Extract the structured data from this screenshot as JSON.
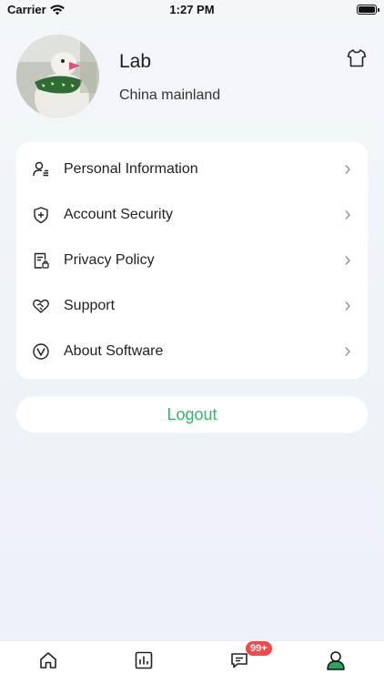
{
  "status_bar": {
    "carrier": "Carrier",
    "time": "1:27 PM"
  },
  "profile": {
    "name": "Lab",
    "region": "China mainland"
  },
  "header": {
    "shirt_icon": "tshirt-icon"
  },
  "menu": {
    "items": [
      {
        "label": "Personal Information",
        "icon": "user-list-icon"
      },
      {
        "label": "Account Security",
        "icon": "shield-plus-icon"
      },
      {
        "label": "Privacy Policy",
        "icon": "document-lock-icon"
      },
      {
        "label": "Support",
        "icon": "heart-handshake-icon"
      },
      {
        "label": "About Software",
        "icon": "v-circle-icon"
      }
    ]
  },
  "logout": {
    "label": "Logout"
  },
  "tab_bar": {
    "tabs": [
      {
        "name": "home",
        "icon": "home-icon"
      },
      {
        "name": "stats",
        "icon": "bar-chart-icon"
      },
      {
        "name": "messages",
        "icon": "chat-icon"
      },
      {
        "name": "profile",
        "icon": "user-icon"
      }
    ],
    "messages_badge": "99+"
  },
  "colors": {
    "accent": "#2db86b",
    "badge": "#f04a4a",
    "text_primary": "#1f1f1f",
    "background": "#f3f7fa"
  }
}
